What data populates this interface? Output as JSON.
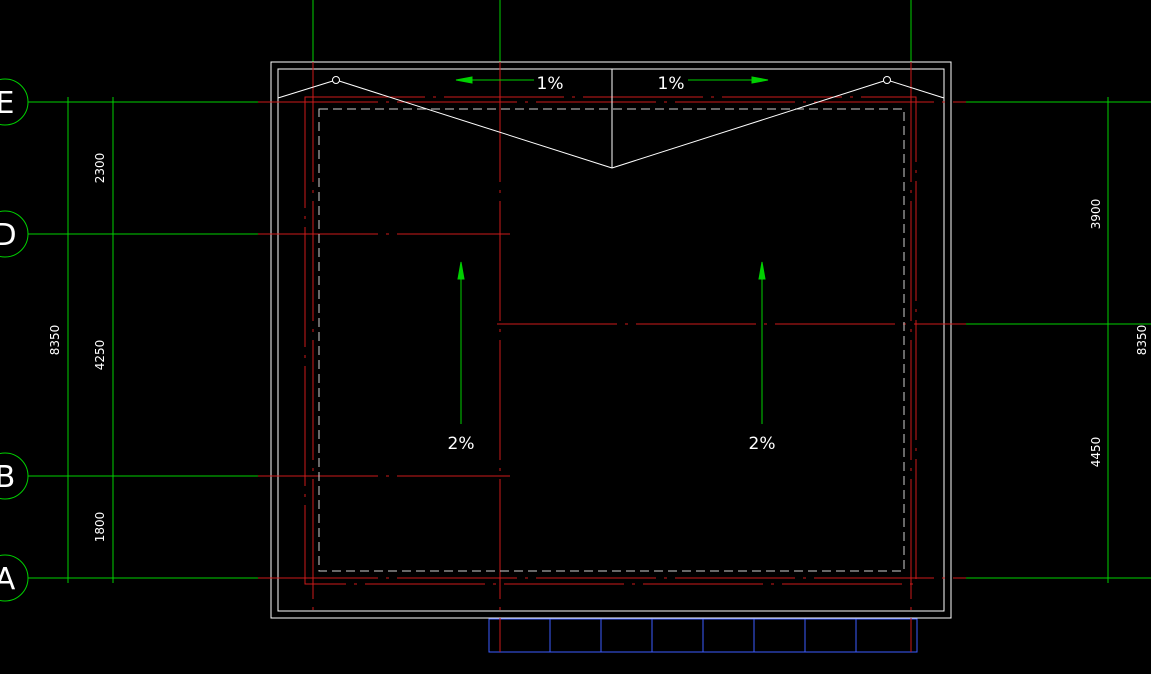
{
  "colors": {
    "background": "#000000",
    "axis_line": "#00d000",
    "axis_bubble": "#00d000",
    "dimension": "#00d000",
    "outline": "#ffffff",
    "red_dashdot": "#cc1a1a",
    "dashed_inner": "#cfcfcf",
    "slope_arrow": "#00d000",
    "text": "#ffffff",
    "ground_grid": "#3c5cff"
  },
  "axes": [
    {
      "id": "E",
      "label": "E"
    },
    {
      "id": "D",
      "label": "D"
    },
    {
      "id": "B",
      "label": "B"
    },
    {
      "id": "A",
      "label": "A"
    }
  ],
  "dimensions": {
    "left_segments": [
      "2300",
      "4250",
      "1800"
    ],
    "left_total": "8350",
    "right_segments": [
      "3900",
      "4450"
    ],
    "right_total": "8350"
  },
  "slopes": {
    "ridge_left": "1%",
    "ridge_right": "1%",
    "roof_left": "2%",
    "roof_right": "2%"
  },
  "icons": {
    "slope_arrow": "arrow-icon",
    "axis_bubble": "axis-bubble-icon"
  }
}
